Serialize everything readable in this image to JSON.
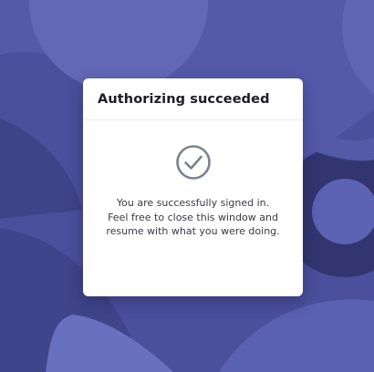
{
  "dialog": {
    "title": "Authorizing succeeded",
    "icon": "check-circle-icon",
    "message_lines": [
      "You are successfully signed in.",
      "Feel free to close this window and",
      "resume with what you were doing."
    ]
  },
  "colors": {
    "background": "#4b4f9c",
    "background_light": "#5c62b4",
    "background_dark": "#353978",
    "card": "#ffffff",
    "icon_stroke": "#7a8290",
    "title_text": "#1c1c24",
    "body_text": "#3a3a44"
  }
}
